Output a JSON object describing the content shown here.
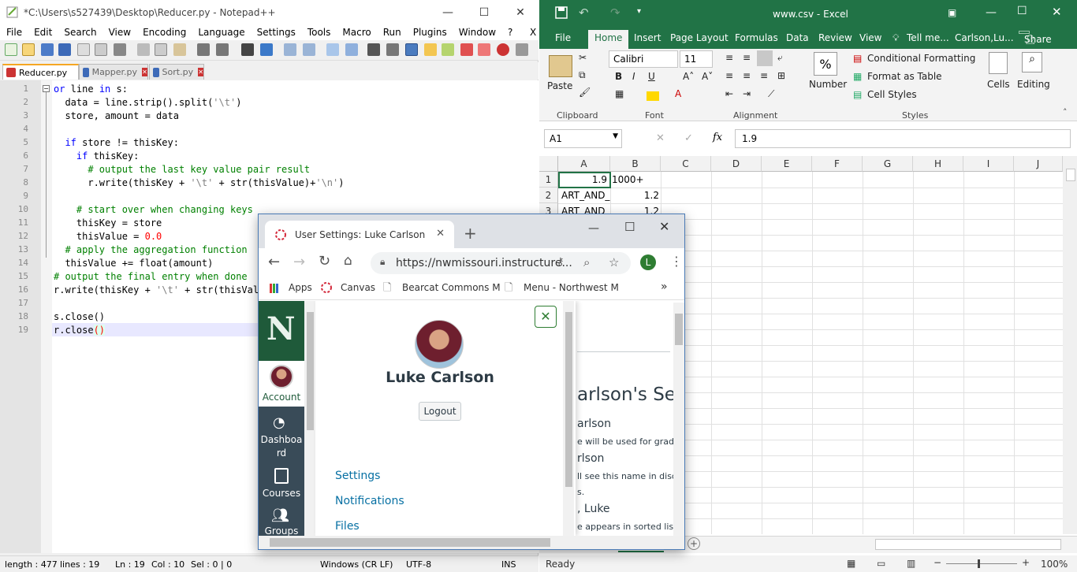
{
  "notepad": {
    "title": "*C:\\Users\\s527439\\Desktop\\Reducer.py - Notepad++",
    "menu": [
      "File",
      "Edit",
      "Search",
      "View",
      "Encoding",
      "Language",
      "Settings",
      "Tools",
      "Macro",
      "Run",
      "Plugins",
      "Window",
      "?"
    ],
    "menu_close": "X",
    "tabs": [
      {
        "label": "Reducer.py",
        "active": true
      },
      {
        "label": "Mapper.py",
        "active": false
      },
      {
        "label": "Sort.py",
        "active": false
      }
    ],
    "line_numbers": [
      "1",
      "2",
      "3",
      "4",
      "5",
      "6",
      "7",
      "8",
      "9",
      "10",
      "11",
      "12",
      "13",
      "14",
      "15",
      "16",
      "17",
      "18",
      "19"
    ],
    "status": {
      "length": "length : 477",
      "lines": "lines : 19",
      "ln": "Ln : 19",
      "col": "Col : 10",
      "sel": "Sel : 0 | 0",
      "eol": "Windows (CR LF)",
      "encoding": "UTF-8",
      "mode": "INS"
    }
  },
  "excel": {
    "title": "www.csv - Excel",
    "tabs": [
      "File",
      "Home",
      "Insert",
      "Page Layout",
      "Formulas",
      "Data",
      "Review",
      "View"
    ],
    "tell_me": "Tell me...",
    "user": "Carlson,Lu...",
    "share": "Share",
    "ribbon": {
      "paste": "Paste",
      "font_name": "Calibri",
      "font_size": "11",
      "conditional_formatting": "Conditional Formatting",
      "format_as_table": "Format as Table",
      "cell_styles": "Cell Styles",
      "number": "Number",
      "cells": "Cells",
      "editing": "Editing",
      "groups": [
        "Clipboard",
        "Font",
        "Alignment",
        "Styles"
      ]
    },
    "name_box": "A1",
    "formula": "1.9",
    "columns": [
      "A",
      "B",
      "C",
      "D",
      "E",
      "F",
      "G",
      "H",
      "I",
      "J"
    ],
    "rows": [
      "1",
      "2",
      "3"
    ],
    "cells": [
      [
        "1.9",
        "1000+"
      ],
      [
        "ART_AND_",
        "1.2"
      ],
      [
        "ART_AND_",
        "1.2"
      ]
    ],
    "status_ready": "Ready",
    "zoom": "100%"
  },
  "chrome": {
    "tab_title": "User Settings: Luke Carlson",
    "url": "https://nwmissouri.instructure...",
    "profile_initial": "L",
    "bookmarks": [
      "Apps",
      "Canvas",
      "Bearcat Commons M",
      "Menu - Northwest M"
    ],
    "nav": [
      "Account",
      "Dashboard",
      "Courses",
      "Groups"
    ],
    "nav_dash_1": "Dashboa",
    "nav_dash_2": "rd",
    "user_name": "Luke Carlson",
    "logout": "Logout",
    "links": [
      "Settings",
      "Notifications",
      "Files"
    ],
    "bg": {
      "heading": "arlson's Set",
      "l1": "arlson",
      "l2": "e will be used for grading",
      "l3": "rlson",
      "l4": "ll see this name in discus",
      "l5": "s.",
      "l6": ", Luke",
      "l7": "e appears in sorted lists."
    }
  }
}
